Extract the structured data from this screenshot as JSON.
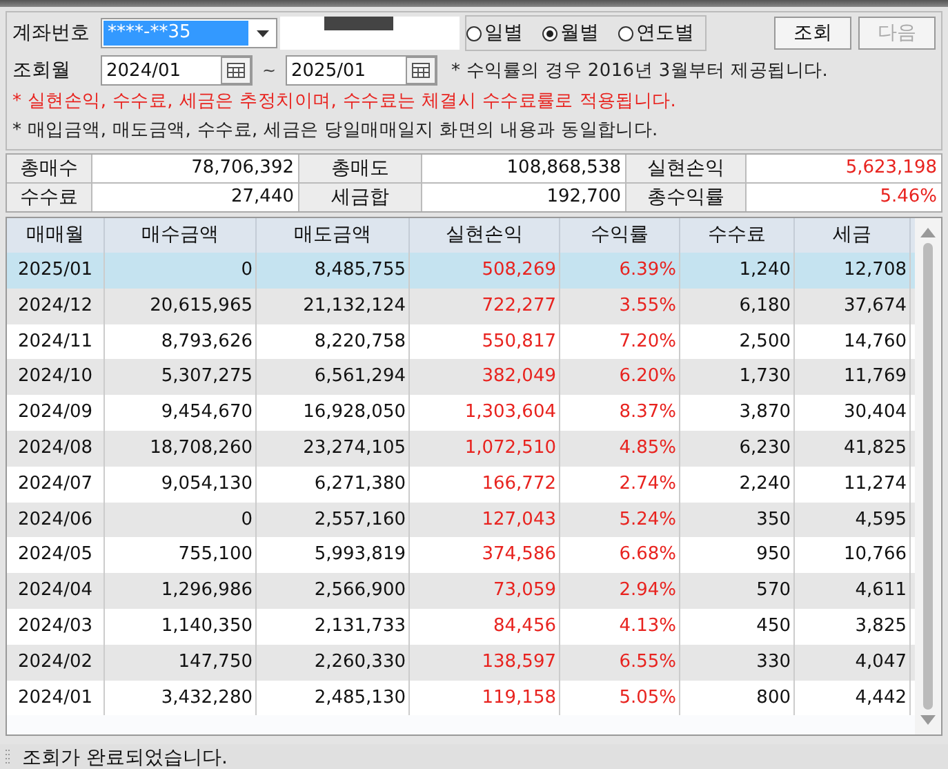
{
  "account": {
    "label": "계좌번호",
    "value": "****-**35"
  },
  "period_options": [
    {
      "label": "일별",
      "selected": false
    },
    {
      "label": "월별",
      "selected": true
    },
    {
      "label": "연도별",
      "selected": false
    }
  ],
  "buttons": [
    {
      "label": "조회",
      "disabled": false
    },
    {
      "label": "다음",
      "disabled": true
    }
  ],
  "range": {
    "label": "조회월",
    "from": "2024/01",
    "separator": "~",
    "to": "2025/01"
  },
  "notes": [
    {
      "text": "* 수익률의 경우 2016년 3월부터 제공됩니다.",
      "kind": "info"
    },
    {
      "text": "* 실현손익, 수수료, 세금은 추정치이며, 수수료는 체결시 수수료률로 적용됩니다.",
      "kind": "warning"
    },
    {
      "text": "* 매입금액, 매도금액, 수수료, 세금은 당일매매일지 화면의 내용과 동일합니다.",
      "kind": "info"
    }
  ],
  "summary": [
    [
      {
        "label": "총매수",
        "value": "78,706,392",
        "kind": "plain"
      },
      {
        "label": "총매도",
        "value": "108,868,538",
        "kind": "plain"
      },
      {
        "label": "실현손익",
        "value": "5,623,198",
        "kind": "profit"
      }
    ],
    [
      {
        "label": "수수료",
        "value": "27,440",
        "kind": "plain"
      },
      {
        "label": "세금합",
        "value": "192,700",
        "kind": "plain"
      },
      {
        "label": "총수익률",
        "value": "5.46%",
        "kind": "profit"
      }
    ]
  ],
  "table": {
    "columns": [
      {
        "label": "매매월",
        "kind": "text"
      },
      {
        "label": "매수금액",
        "kind": "number"
      },
      {
        "label": "매도금액",
        "kind": "number"
      },
      {
        "label": "실현손익",
        "kind": "profit"
      },
      {
        "label": "수익률",
        "kind": "profit"
      },
      {
        "label": "수수료",
        "kind": "number"
      },
      {
        "label": "세금",
        "kind": "number"
      }
    ],
    "rows": [
      {
        "selected": true,
        "cells": [
          "2025/01",
          "0",
          "8,485,755",
          "508,269",
          "6.39%",
          "1,240",
          "12,708"
        ]
      },
      {
        "selected": false,
        "cells": [
          "2024/12",
          "20,615,965",
          "21,132,124",
          "722,277",
          "3.55%",
          "6,180",
          "37,674"
        ]
      },
      {
        "selected": false,
        "cells": [
          "2024/11",
          "8,793,626",
          "8,220,758",
          "550,817",
          "7.20%",
          "2,500",
          "14,760"
        ]
      },
      {
        "selected": false,
        "cells": [
          "2024/10",
          "5,307,275",
          "6,561,294",
          "382,049",
          "6.20%",
          "1,730",
          "11,769"
        ]
      },
      {
        "selected": false,
        "cells": [
          "2024/09",
          "9,454,670",
          "16,928,050",
          "1,303,604",
          "8.37%",
          "3,870",
          "30,404"
        ]
      },
      {
        "selected": false,
        "cells": [
          "2024/08",
          "18,708,260",
          "23,274,105",
          "1,072,510",
          "4.85%",
          "6,230",
          "41,825"
        ]
      },
      {
        "selected": false,
        "cells": [
          "2024/07",
          "9,054,130",
          "6,271,380",
          "166,772",
          "2.74%",
          "2,240",
          "11,274"
        ]
      },
      {
        "selected": false,
        "cells": [
          "2024/06",
          "0",
          "2,557,160",
          "127,043",
          "5.24%",
          "350",
          "4,595"
        ]
      },
      {
        "selected": false,
        "cells": [
          "2024/05",
          "755,100",
          "5,993,819",
          "374,586",
          "6.68%",
          "950",
          "10,766"
        ]
      },
      {
        "selected": false,
        "cells": [
          "2024/04",
          "1,296,986",
          "2,566,900",
          "73,059",
          "2.94%",
          "570",
          "4,611"
        ]
      },
      {
        "selected": false,
        "cells": [
          "2024/03",
          "1,140,350",
          "2,131,733",
          "84,456",
          "4.13%",
          "450",
          "3,825"
        ]
      },
      {
        "selected": false,
        "cells": [
          "2024/02",
          "147,750",
          "2,260,330",
          "138,597",
          "6.55%",
          "330",
          "4,047"
        ]
      },
      {
        "selected": false,
        "cells": [
          "2024/01",
          "3,432,280",
          "2,485,130",
          "119,158",
          "5.05%",
          "800",
          "4,442"
        ]
      }
    ]
  },
  "status_bar": {
    "message": "조회가 완료되었습니다."
  }
}
